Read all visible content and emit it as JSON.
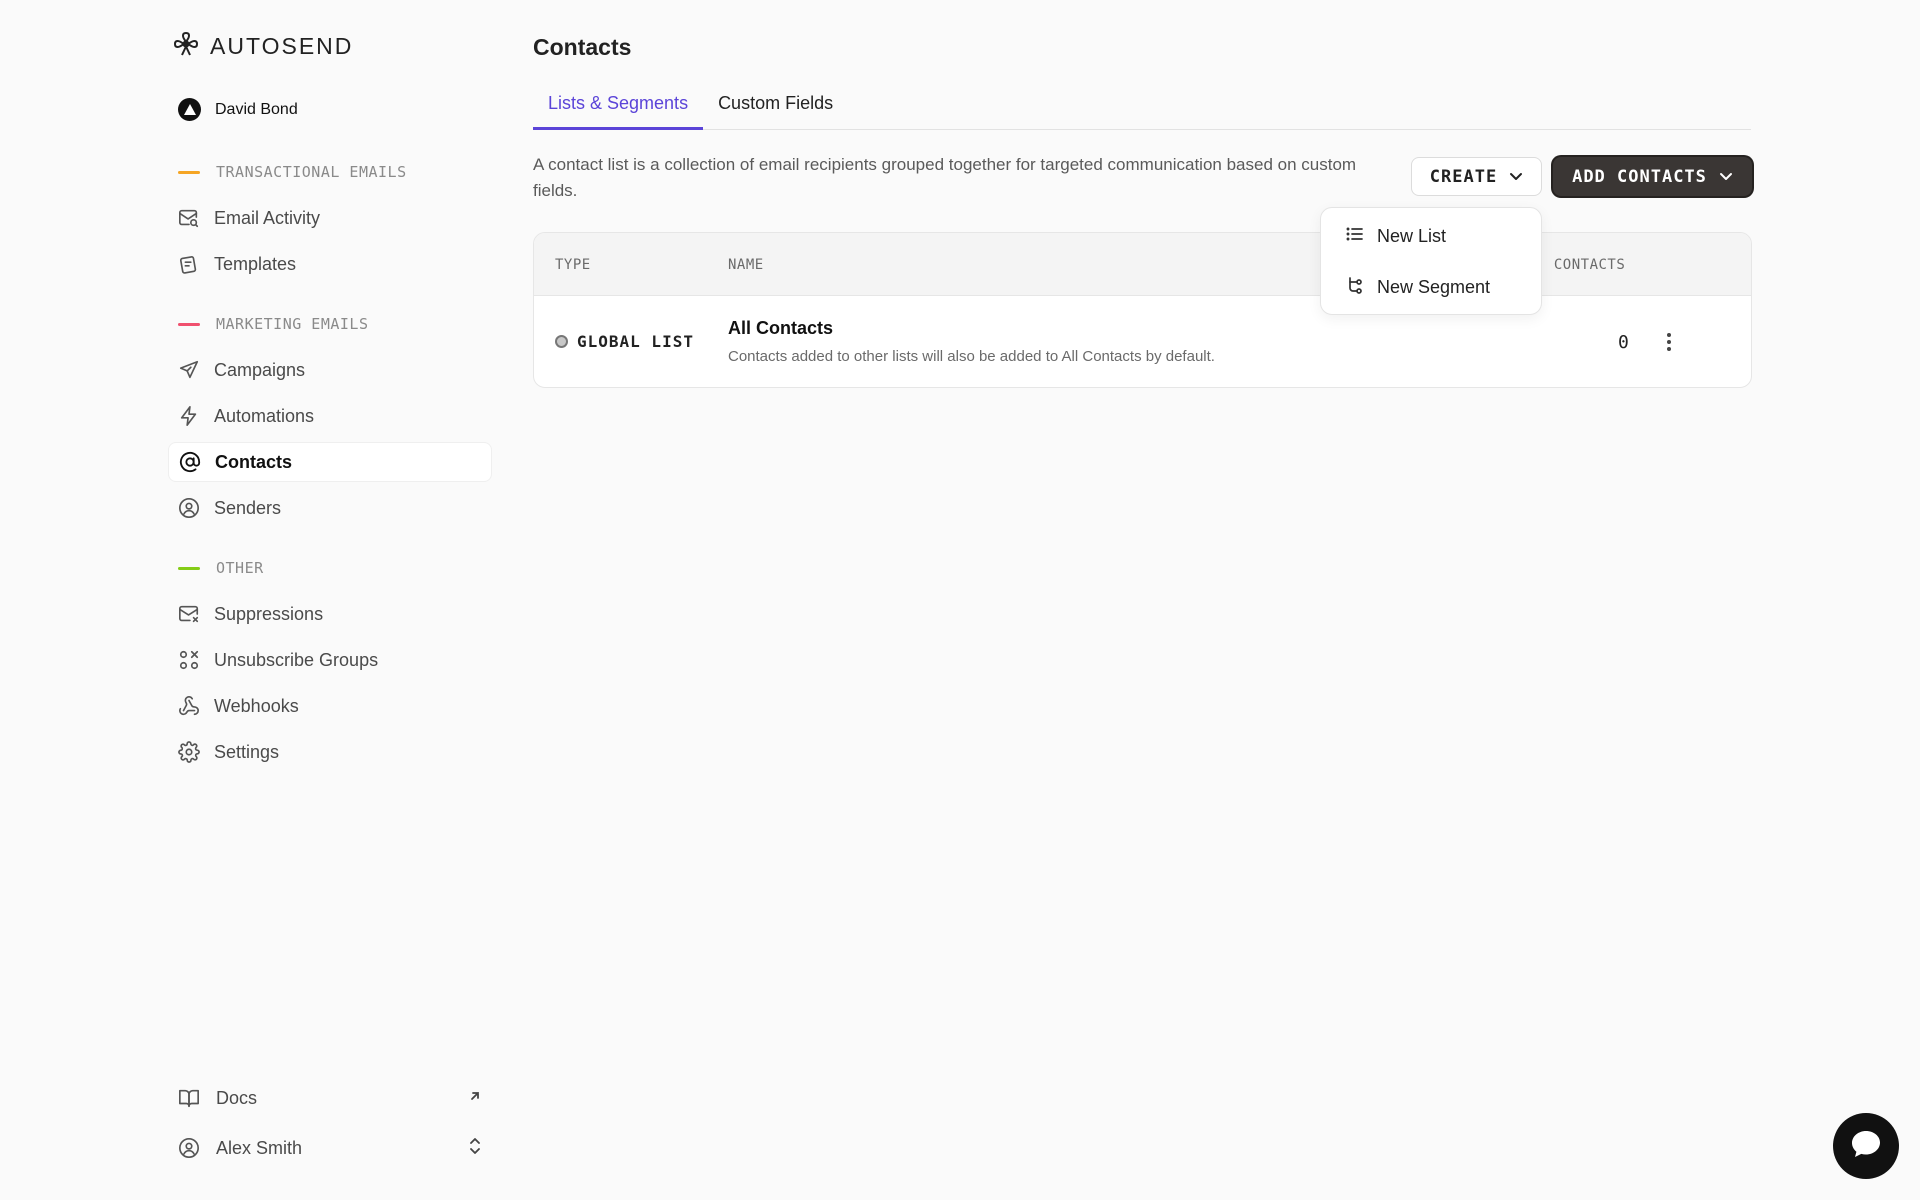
{
  "app": {
    "brand": "AUTOSEND",
    "account_name": "David Bond"
  },
  "sidebar": {
    "sections": [
      {
        "label": "TRANSACTIONAL EMAILS",
        "color": "#f5a524"
      },
      {
        "label": "MARKETING EMAILS",
        "color": "#f0506e"
      },
      {
        "label": "OTHER",
        "color": "#84cc16"
      }
    ],
    "items": [
      {
        "label": "Email Activity",
        "icon": "mail-search-icon"
      },
      {
        "label": "Templates",
        "icon": "templates-icon"
      },
      {
        "label": "Campaigns",
        "icon": "send-icon"
      },
      {
        "label": "Automations",
        "icon": "bolt-icon"
      },
      {
        "label": "Contacts",
        "icon": "at-sign-icon",
        "active": true
      },
      {
        "label": "Senders",
        "icon": "user-circle-icon"
      },
      {
        "label": "Suppressions",
        "icon": "mail-x-icon"
      },
      {
        "label": "Unsubscribe Groups",
        "icon": "groups-icon"
      },
      {
        "label": "Webhooks",
        "icon": "webhook-icon"
      },
      {
        "label": "Settings",
        "icon": "gear-icon"
      }
    ],
    "bottom": {
      "docs_label": "Docs",
      "user_name": "Alex Smith"
    }
  },
  "main": {
    "title": "Contacts",
    "tabs": [
      {
        "label": "Lists & Segments",
        "active": true
      },
      {
        "label": "Custom Fields"
      }
    ],
    "description": "A contact list is a collection of email recipients grouped together for targeted communication based on custom fields.",
    "create_label": "CREATE",
    "add_contacts_label": "ADD CONTACTS",
    "create_menu": {
      "items": [
        {
          "label": "New List",
          "icon": "list-icon"
        },
        {
          "label": "New Segment",
          "icon": "segment-icon"
        }
      ]
    },
    "table": {
      "columns": {
        "type": "TYPE",
        "name": "NAME",
        "contacts": ". CONTACTS"
      },
      "rows": [
        {
          "type": "GLOBAL LIST",
          "name": "All Contacts",
          "description": "Contacts added to other lists will also be added to All Contacts by default.",
          "count": "0"
        }
      ]
    }
  },
  "accent_color": "#5b44d8"
}
